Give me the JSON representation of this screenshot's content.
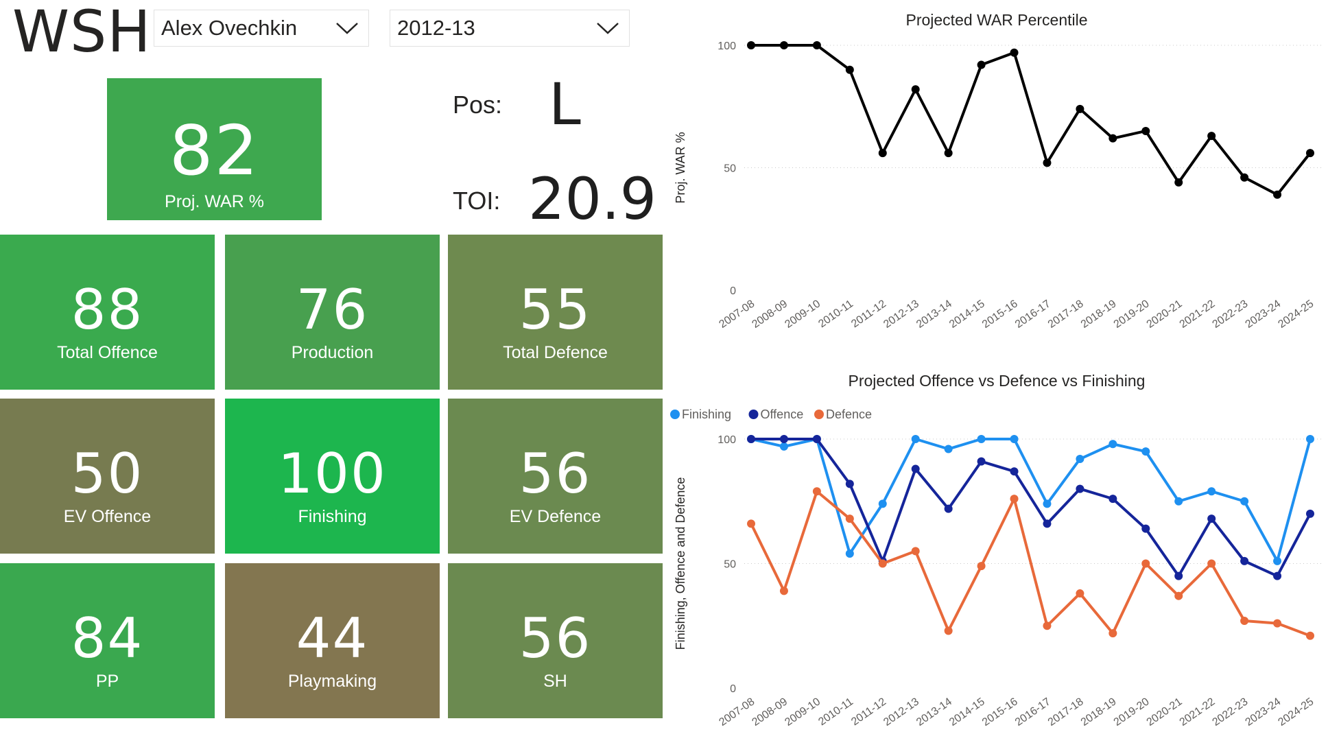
{
  "team": "WSH",
  "filters": {
    "player": "Alex Ovechkin",
    "season": "2012-13"
  },
  "position": {
    "label": "Pos:",
    "value": "L"
  },
  "toi": {
    "label": "TOI:",
    "value": "20.9"
  },
  "tiles": {
    "proj_war": {
      "value": "82",
      "label": "Proj. WAR %",
      "color": "#3ea84f"
    },
    "total_offence": {
      "value": "88",
      "label": "Total Offence",
      "color": "#3aaa4e"
    },
    "production": {
      "value": "76",
      "label": "Production",
      "color": "#48a04f"
    },
    "total_defence": {
      "value": "55",
      "label": "Total Defence",
      "color": "#6e8a4f"
    },
    "ev_offence": {
      "value": "50",
      "label": "EV Offence",
      "color": "#777b50"
    },
    "finishing": {
      "value": "100",
      "label": "Finishing",
      "color": "#1db64e"
    },
    "ev_defence": {
      "value": "56",
      "label": "EV Defence",
      "color": "#6b8a50"
    },
    "pp": {
      "value": "84",
      "label": "PP",
      "color": "#3aa84f"
    },
    "playmaking": {
      "value": "44",
      "label": "Playmaking",
      "color": "#837650"
    },
    "sh": {
      "value": "56",
      "label": "SH",
      "color": "#6b8a50"
    }
  },
  "chart_data": [
    {
      "type": "line",
      "title": "Projected WAR Percentile",
      "ylabel": "Proj. WAR %",
      "xlabel": "",
      "ylim": [
        0,
        100
      ],
      "yticks": [
        0,
        50,
        100
      ],
      "grid": true,
      "categories": [
        "2007-08",
        "2008-09",
        "2009-10",
        "2010-11",
        "2011-12",
        "2012-13",
        "2013-14",
        "2014-15",
        "2015-16",
        "2016-17",
        "2017-18",
        "2018-19",
        "2019-20",
        "2020-21",
        "2021-22",
        "2022-23",
        "2023-24",
        "2024-25"
      ],
      "series": [
        {
          "name": "",
          "color": "#000000",
          "values": [
            100,
            100,
            100,
            90,
            56,
            82,
            56,
            92,
            97,
            52,
            74,
            62,
            65,
            44,
            63,
            46,
            39,
            56
          ]
        }
      ]
    },
    {
      "type": "line",
      "title": "Projected Offence vs Defence vs Finishing",
      "ylabel": "Finishing, Offence and Defence",
      "xlabel": "",
      "ylim": [
        0,
        100
      ],
      "yticks": [
        0,
        50,
        100
      ],
      "grid": true,
      "legend": "top-left",
      "categories": [
        "2007-08",
        "2008-09",
        "2009-10",
        "2010-11",
        "2011-12",
        "2012-13",
        "2013-14",
        "2014-15",
        "2015-16",
        "2016-17",
        "2017-18",
        "2018-19",
        "2019-20",
        "2020-21",
        "2021-22",
        "2022-23",
        "2023-24",
        "2024-25"
      ],
      "series": [
        {
          "name": "Finishing",
          "color": "#1e90f0",
          "values": [
            100,
            97,
            100,
            54,
            74,
            100,
            96,
            100,
            100,
            74,
            92,
            98,
            95,
            75,
            79,
            75,
            51,
            100
          ]
        },
        {
          "name": "Offence",
          "color": "#15259a",
          "values": [
            100,
            100,
            100,
            82,
            51,
            88,
            72,
            91,
            87,
            66,
            80,
            76,
            64,
            45,
            68,
            51,
            45,
            70
          ]
        },
        {
          "name": "Defence",
          "color": "#e8693a",
          "values": [
            66,
            39,
            79,
            68,
            50,
            55,
            23,
            49,
            76,
            25,
            38,
            22,
            50,
            37,
            50,
            27,
            26,
            21
          ]
        }
      ]
    }
  ]
}
